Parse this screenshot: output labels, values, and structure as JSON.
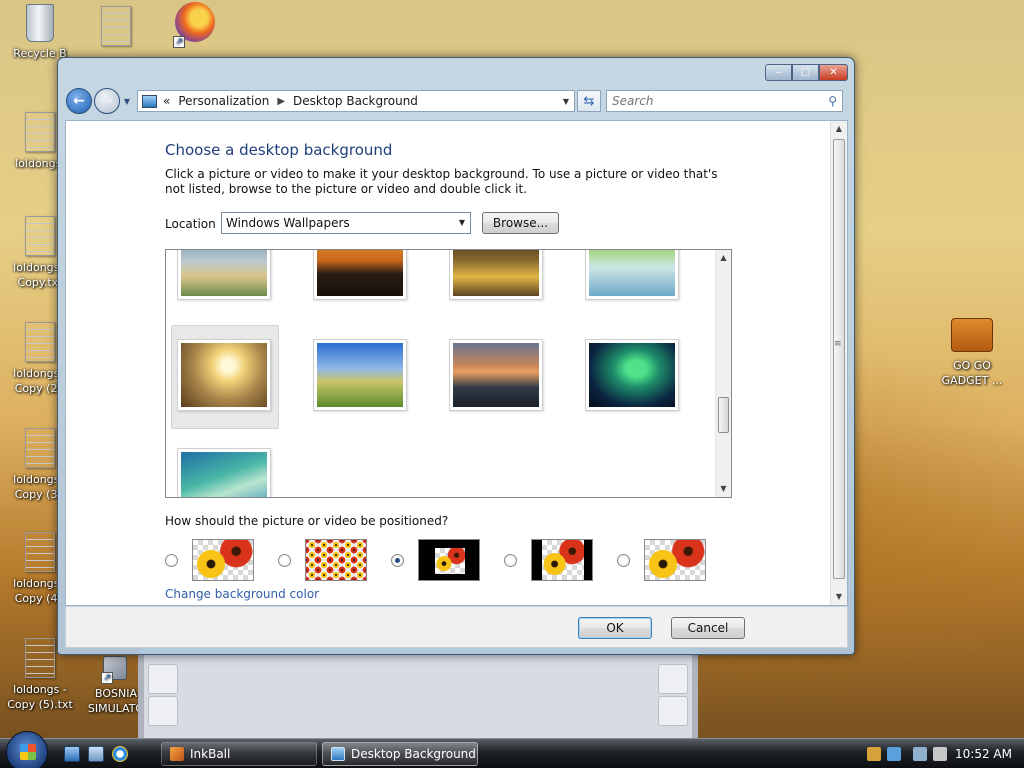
{
  "desktop": {
    "icons": [
      {
        "label": "Recycle B",
        "kind": "bin"
      },
      {
        "label": "",
        "kind": "file"
      },
      {
        "label": "",
        "kind": "firefox"
      },
      {
        "label": "loldongs.",
        "kind": "file"
      },
      {
        "label": "loldongs - Copy.txt",
        "kind": "file"
      },
      {
        "label": "loldongs - Copy (2).",
        "kind": "file"
      },
      {
        "label": "loldongs - Copy (3).",
        "kind": "file"
      },
      {
        "label": "loldongs - Copy (4).",
        "kind": "file"
      },
      {
        "label": "loldongs - Copy (5).txt",
        "kind": "file"
      },
      {
        "label": "BOSNIA SIMULATO",
        "kind": "app"
      },
      {
        "label": "GO GO GADGET ...",
        "kind": "briefcase"
      }
    ]
  },
  "window": {
    "title_buttons": {
      "minimize": "–",
      "maximize": "□",
      "close": "✕"
    },
    "breadcrumb": {
      "root_chevrons": "«",
      "items": [
        "Personalization",
        "Desktop Background"
      ],
      "separator": "▶"
    },
    "search_placeholder": "Search",
    "heading": "Choose a desktop background",
    "description": "Click a picture or video to make it your desktop background. To use a picture or video that's not listed, browse to the picture or video and double click it.",
    "location_label": "Location",
    "location_value": "Windows Wallpapers",
    "browse_label": "Browse...",
    "wallpapers": [
      {
        "name": "wallpaper-lake",
        "gradient": "linear-gradient(180deg,#6a8fb0 0%,#b9c9cf 45%,#d7c48a 70%,#6e8a4a 100%)"
      },
      {
        "name": "wallpaper-sunset-mountains",
        "gradient": "linear-gradient(180deg,#f1a23a 0%,#c7651a 45%,#2b1d12 65%,#16110b 100%)"
      },
      {
        "name": "wallpaper-rocks-golden",
        "gradient": "linear-gradient(180deg,#2a2219 0%,#8b6a2c 45%,#e1b545 70%,#5b4521 100%)"
      },
      {
        "name": "wallpaper-palm",
        "gradient": "linear-gradient(180deg,#6fbf4c 0%,#a9d68a 30%,#cde7e6 55%,#6fa9c8 100%)"
      },
      {
        "name": "wallpaper-wheat-sunrise",
        "gradient": "radial-gradient(circle at 55% 35%,#fff8d6 0 10%,#f2d37a 25%,#a8864a 55%,#5a3a1c 100%)",
        "selected": true
      },
      {
        "name": "wallpaper-green-hills",
        "gradient": "linear-gradient(180deg,#2b6fd0 0%,#8fb8e6 40%,#c9c66a 60%,#5d8a2a 100%)"
      },
      {
        "name": "wallpaper-canyon-reflection",
        "gradient": "linear-gradient(180deg,#6a7690 0%,#c7865a 35%,#e8a062 45%,#2f3a46 70%,#1b2028 100%)"
      },
      {
        "name": "wallpaper-aurora",
        "gradient": "radial-gradient(ellipse at 55% 40%,#4fe28a 0 15%,#1d8a6a 35%,#0b2440 70%,#050c18 100%)"
      },
      {
        "name": "wallpaper-vista-aurora",
        "gradient": "linear-gradient(160deg,#1f6fa6 0%,#48b6a6 40%,#b8e6d0 60%,#2a7fb0 100%)"
      }
    ],
    "position_question": "How should the picture or video be positioned?",
    "position_options": [
      {
        "name": "fill",
        "selected": false
      },
      {
        "name": "tile",
        "selected": false
      },
      {
        "name": "center",
        "selected": true
      },
      {
        "name": "fit",
        "selected": false
      },
      {
        "name": "stretch",
        "selected": false
      }
    ],
    "change_bg_color": "Change background color",
    "ok_label": "OK",
    "cancel_label": "Cancel"
  },
  "taskbar": {
    "tasks": [
      {
        "label": "InkBall",
        "active": false
      },
      {
        "label": "Desktop Background",
        "active": true
      }
    ],
    "clock": "10:52 AM"
  }
}
